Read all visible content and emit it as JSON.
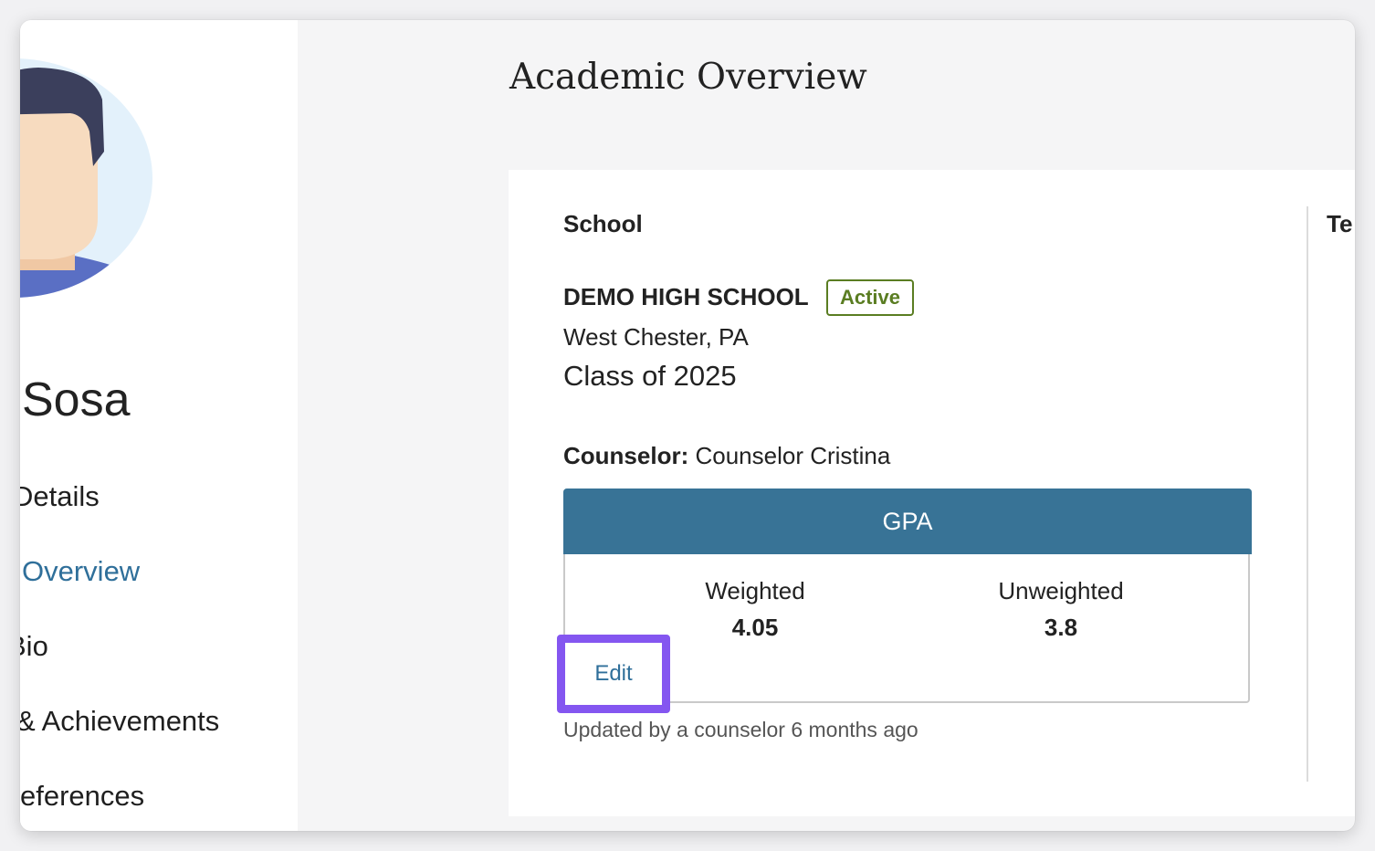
{
  "sidebar": {
    "student_name": "Sosa",
    "nav": [
      {
        "label": "Details"
      },
      {
        "label": "Overview"
      },
      {
        "label": "Bio"
      },
      {
        "label": "& Achievements"
      },
      {
        "label": "eferences"
      }
    ],
    "active_index": 1
  },
  "main": {
    "title": "Academic Overview",
    "school": {
      "section_label": "School",
      "name": "DEMO HIGH SCHOOL",
      "status": "Active",
      "location": "West Chester, PA",
      "class_of": "Class of 2025",
      "counselor_label": "Counselor:",
      "counselor_name": "Counselor Cristina"
    },
    "second_column_label": "Te",
    "gpa": {
      "title": "GPA",
      "weighted_label": "Weighted",
      "weighted_value": "4.05",
      "unweighted_label": "Unweighted",
      "unweighted_value": "3.8",
      "edit_label": "Edit"
    },
    "updated_text": "Updated by a counselor 6 months ago"
  },
  "colors": {
    "accent": "#2f6f9a",
    "gpa_header": "#387396",
    "active_badge": "#5a7d22",
    "highlight": "#8456f0"
  }
}
